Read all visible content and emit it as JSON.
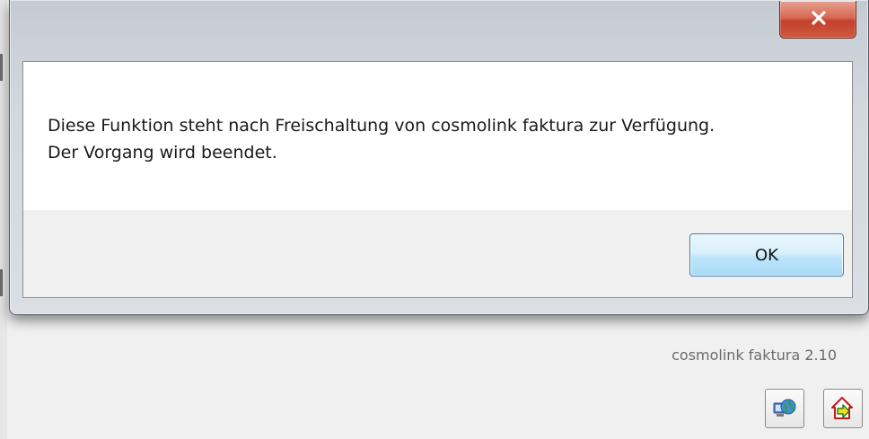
{
  "dialog": {
    "close_icon": "close-icon",
    "message_lines": [
      "Diese Funktion steht nach Freischaltung von cosmolink faktura zur Verfügung.",
      "Der Vorgang wird beendet."
    ],
    "ok_label": "OK"
  },
  "app": {
    "version_label": "cosmolink faktura 2.10",
    "toolbar_icons": [
      "network-icon",
      "exit-icon"
    ]
  },
  "colors": {
    "close_button": "#c94a36",
    "ok_button_border": "#3c7fb1",
    "window_background": "#f0f0f0"
  }
}
